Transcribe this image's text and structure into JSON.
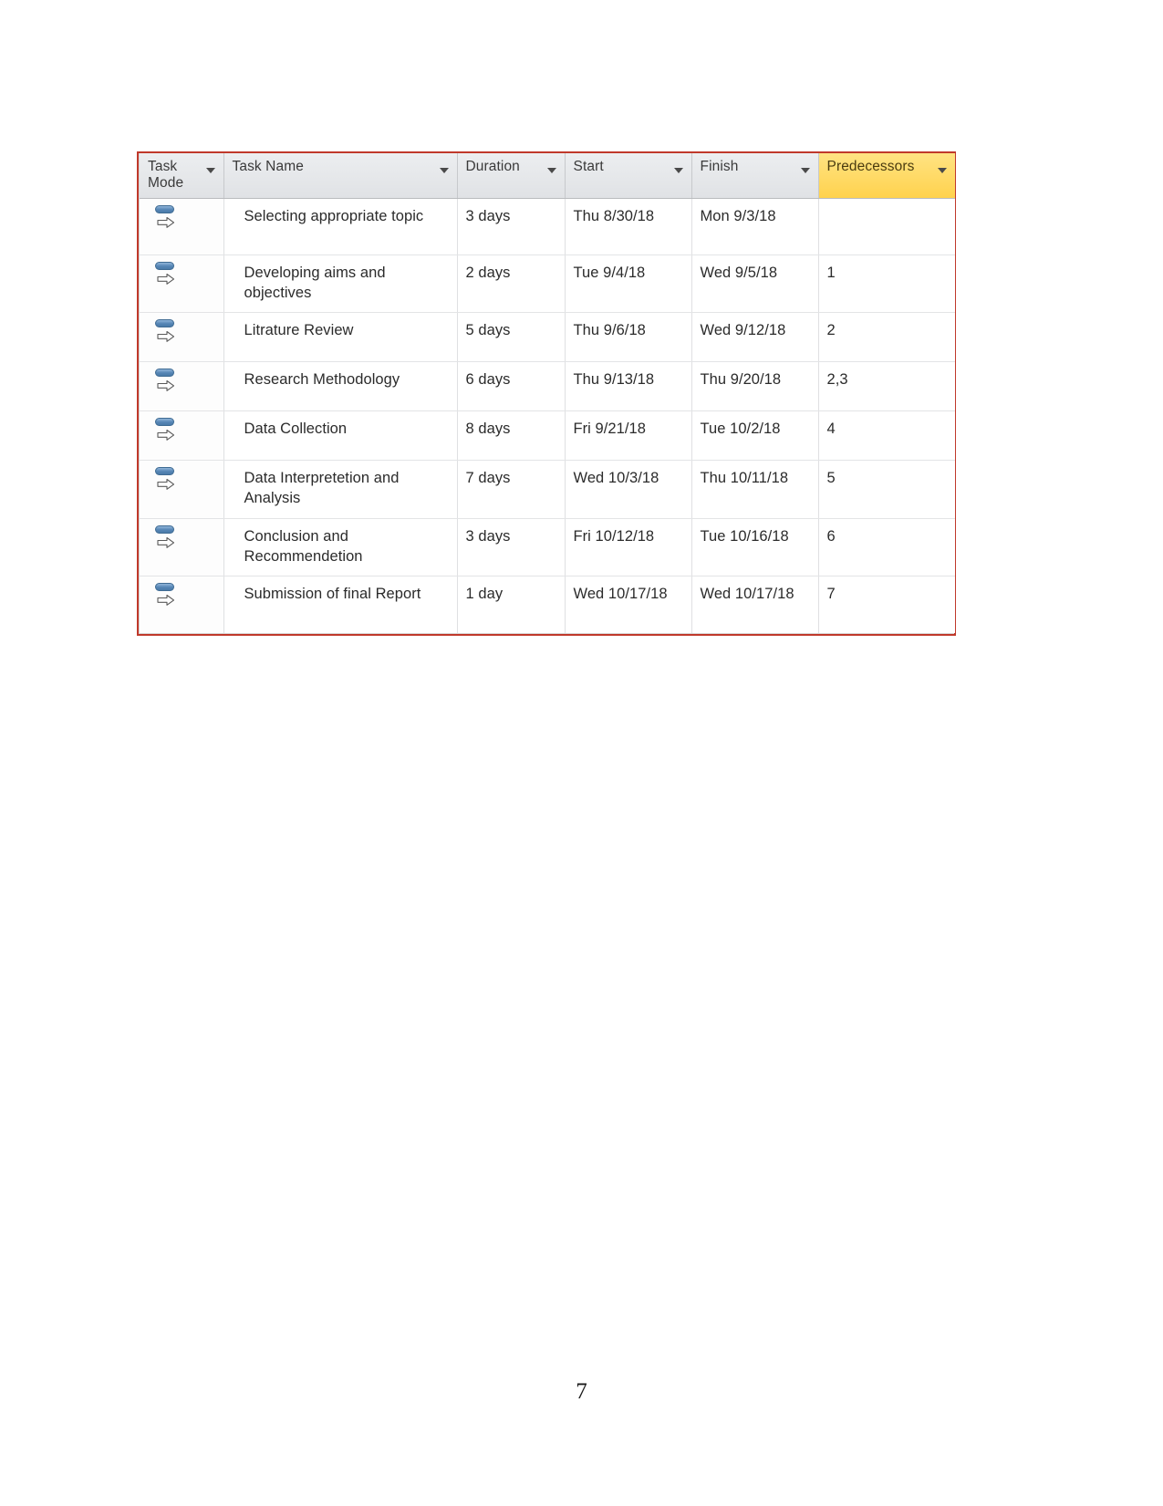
{
  "document": {
    "page_number": "7"
  },
  "table": {
    "accent_border_color": "#c0392b",
    "highlight_color": "#ffd966",
    "header_background": "#e4e6e9",
    "columns": [
      {
        "key": "task_mode",
        "label": "Task Mode",
        "highlighted": false
      },
      {
        "key": "task_name",
        "label": "Task Name",
        "highlighted": false
      },
      {
        "key": "duration",
        "label": "Duration",
        "highlighted": false
      },
      {
        "key": "start",
        "label": "Start",
        "highlighted": false
      },
      {
        "key": "finish",
        "label": "Finish",
        "highlighted": false
      },
      {
        "key": "predecessors",
        "label": "Predecessors",
        "highlighted": true
      }
    ],
    "rows": [
      {
        "task_mode_icon": "auto-schedule-icon",
        "task_name": "Selecting appropriate topic",
        "duration": "3 days",
        "start": "Thu 8/30/18",
        "finish": "Mon 9/3/18",
        "predecessors": ""
      },
      {
        "task_mode_icon": "auto-schedule-icon",
        "task_name": "Developing aims and objectives",
        "duration": "2 days",
        "start": "Tue 9/4/18",
        "finish": "Wed 9/5/18",
        "predecessors": "1"
      },
      {
        "task_mode_icon": "auto-schedule-icon",
        "task_name": "Litrature Review",
        "duration": "5 days",
        "start": "Thu 9/6/18",
        "finish": "Wed 9/12/18",
        "predecessors": "2"
      },
      {
        "task_mode_icon": "auto-schedule-icon",
        "task_name": "Research Methodology",
        "duration": "6 days",
        "start": "Thu 9/13/18",
        "finish": "Thu 9/20/18",
        "predecessors": "2,3"
      },
      {
        "task_mode_icon": "auto-schedule-icon",
        "task_name": "Data Collection",
        "duration": "8 days",
        "start": "Fri 9/21/18",
        "finish": "Tue 10/2/18",
        "predecessors": "4"
      },
      {
        "task_mode_icon": "auto-schedule-icon",
        "task_name": "Data Interpretetion and Analysis",
        "duration": "7 days",
        "start": "Wed 10/3/18",
        "finish": "Thu 10/11/18",
        "predecessors": "5"
      },
      {
        "task_mode_icon": "auto-schedule-icon",
        "task_name": "Conclusion and Recommendetion",
        "duration": "3 days",
        "start": "Fri 10/12/18",
        "finish": "Tue 10/16/18",
        "predecessors": "6"
      },
      {
        "task_mode_icon": "auto-schedule-icon",
        "task_name": "Submission of final Report",
        "duration": "1 day",
        "start": "Wed 10/17/18",
        "finish": "Wed 10/17/18",
        "predecessors": "7"
      }
    ]
  }
}
